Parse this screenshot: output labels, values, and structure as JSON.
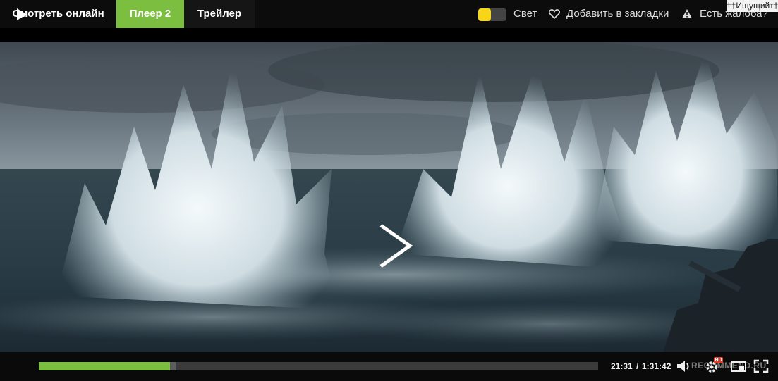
{
  "tabs": {
    "watch_online": "Смотреть онлайн",
    "player2": "Плеер 2",
    "trailer": "Трейлер"
  },
  "actions": {
    "light_label": "Свет",
    "favorite_label": "Добавить в закладки",
    "complaint_label": "Есть жалоба?"
  },
  "corner_tag": "††Ищущийт†",
  "player": {
    "current_time": "21:31",
    "separator": "/",
    "duration": "1:31:42",
    "progress": 0.2347,
    "buffered": 0.2464,
    "hd_badge": "HD",
    "watermark": "RECOMMEND.RU"
  },
  "colors": {
    "accent": "#7cbe3f",
    "toggle_knob": "#f6d51a",
    "hd_badge": "#e23b2e"
  },
  "icons": [
    "heart-icon",
    "warning-icon",
    "play-icon",
    "volume-icon",
    "settings-icon",
    "pip-icon",
    "fullscreen-icon"
  ]
}
